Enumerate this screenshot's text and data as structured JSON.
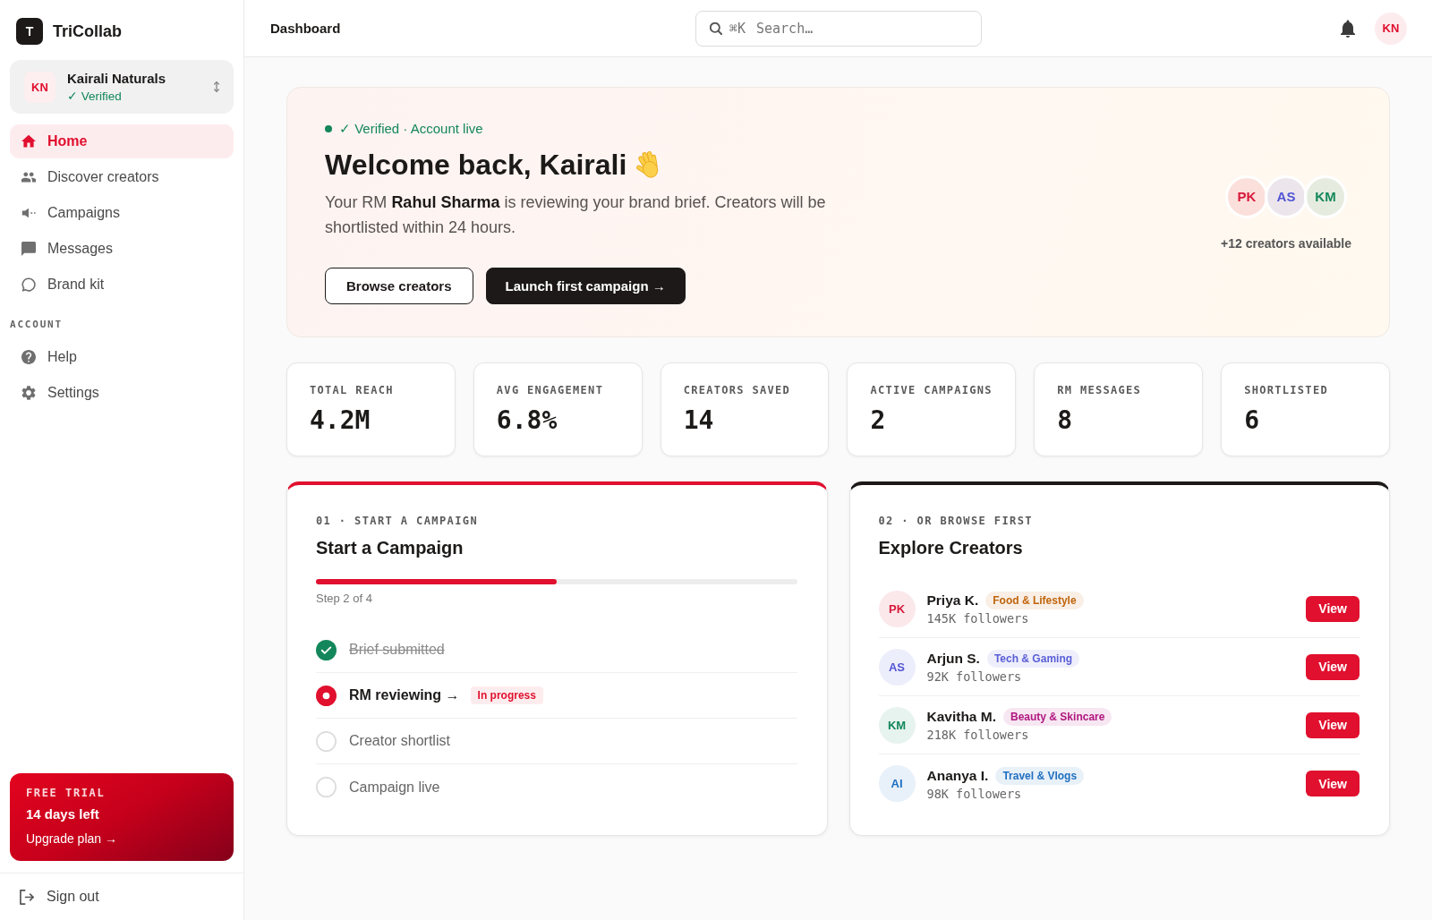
{
  "sidebar": {
    "brand": {
      "mark": "T",
      "name": "TriCollab"
    },
    "account": {
      "initials": "KN",
      "name": "Kairali Naturals",
      "status": "✓ Verified"
    },
    "nav": [
      {
        "label": "Home",
        "selected": true
      },
      {
        "label": "Discover creators",
        "selected": false
      },
      {
        "label": "Campaigns",
        "selected": false
      },
      {
        "label": "Messages",
        "selected": false
      },
      {
        "label": "Brand kit",
        "selected": false
      }
    ],
    "section_title": "ACCOUNT",
    "account_nav": [
      {
        "label": "Help",
        "selected": false
      },
      {
        "label": "Settings",
        "selected": false
      }
    ],
    "trial": {
      "eyebrow": "FREE TRIAL",
      "title": "14 days left",
      "link": "Upgrade plan →"
    },
    "sign_out": "Sign out"
  },
  "header": {
    "title": "Dashboard",
    "search": {
      "shortcut": "⌘K",
      "placeholder": "Search…"
    },
    "avatar": "KN"
  },
  "hero": {
    "status": "✓ Verified · Account live",
    "title": "Welcome back, Kairali",
    "message": "Your RM **Rahul Sharma** is reviewing your brand brief. Creators will be shortlisted within 24 hours.",
    "buttons": [
      {
        "label": "Browse creators",
        "kind": "secondary"
      },
      {
        "label": "Launch first campaign →",
        "kind": "primary"
      }
    ],
    "avatars": [
      {
        "initials": "PK",
        "color": "#d8193a"
      },
      {
        "initials": "AS",
        "color": "#5255d4"
      },
      {
        "initials": "KM",
        "color": "#13875b"
      }
    ],
    "caption": "+12 creators available"
  },
  "stats": [
    {
      "label": "TOTAL REACH",
      "value": "4.2M"
    },
    {
      "label": "AVG ENGAGEMENT",
      "value": "6.8%"
    },
    {
      "label": "CREATORS SAVED",
      "value": "14"
    },
    {
      "label": "ACTIVE CAMPAIGNS",
      "value": "2"
    },
    {
      "label": "RM MESSAGES",
      "value": "8"
    },
    {
      "label": "SHORTLISTED",
      "value": "6"
    }
  ],
  "campaign": {
    "eyebrow": "01 · START A CAMPAIGN",
    "title": "Start a Campaign",
    "progress": {
      "level": 0.5,
      "caption": "Step 2 of 4"
    },
    "steps": [
      {
        "label": "Brief submitted",
        "kind": "done"
      },
      {
        "label": "RM reviewing →",
        "kind": "current",
        "badge": "In progress"
      },
      {
        "label": "Creator shortlist",
        "kind": "pending"
      },
      {
        "label": "Campaign live",
        "kind": "pending"
      }
    ]
  },
  "explore": {
    "eyebrow": "02 · OR BROWSE FIRST",
    "title": "Explore Creators",
    "creators": [
      {
        "initials": "PK",
        "color": "#d8193a",
        "name": "Priya K.",
        "tag": {
          "label": "Food & Lifestyle",
          "color": "#c0650c"
        },
        "followers": "145K followers",
        "action": "View"
      },
      {
        "initials": "AS",
        "color": "#5255d4",
        "name": "Arjun S.",
        "tag": {
          "label": "Tech & Gaming",
          "color": "#5a5ed6"
        },
        "followers": "92K followers",
        "action": "View"
      },
      {
        "initials": "KM",
        "color": "#13875b",
        "name": "Kavitha M.",
        "tag": {
          "label": "Beauty & Skincare",
          "color": "#b0177f"
        },
        "followers": "218K followers",
        "action": "View"
      },
      {
        "initials": "AI",
        "color": "#1d6fc0",
        "name": "Ananya I.",
        "tag": {
          "label": "Travel & Vlogs",
          "color": "#1f6fbf"
        },
        "followers": "98K followers",
        "action": "View"
      }
    ]
  }
}
